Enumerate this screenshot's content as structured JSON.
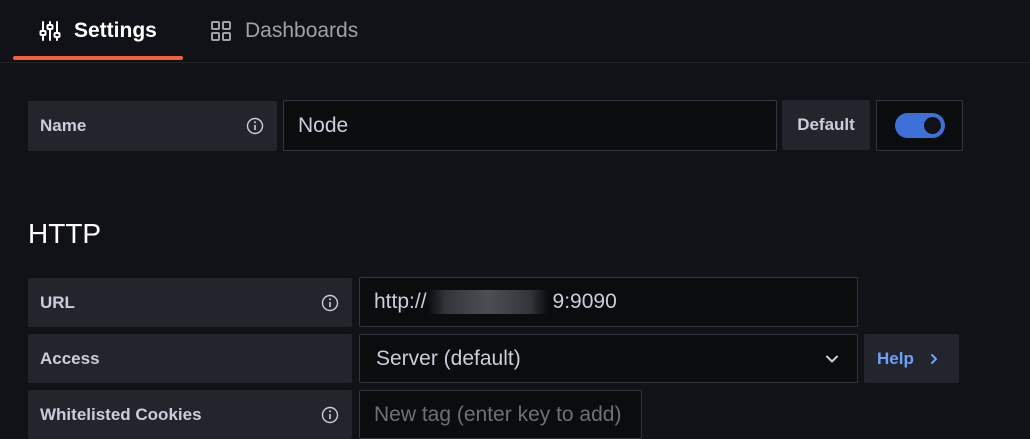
{
  "tabs": [
    {
      "label": "Settings",
      "icon": "sliders-icon",
      "active": true
    },
    {
      "label": "Dashboards",
      "icon": "grid-icon",
      "active": false
    }
  ],
  "name_row": {
    "label": "Name",
    "value": "Node",
    "default_label": "Default",
    "default_enabled": true
  },
  "http_section": {
    "title": "HTTP",
    "url": {
      "label": "URL",
      "value_prefix": "http://",
      "value_suffix": "9:9090"
    },
    "access": {
      "label": "Access",
      "selected": "Server (default)",
      "help_label": "Help"
    },
    "cookies": {
      "label": "Whitelisted Cookies",
      "placeholder": "New tag (enter key to add)"
    }
  },
  "colors": {
    "background": "#111217",
    "accent_underline": "#f55f3e",
    "toggle_on": "#3d71d9",
    "link": "#6e9fff"
  }
}
